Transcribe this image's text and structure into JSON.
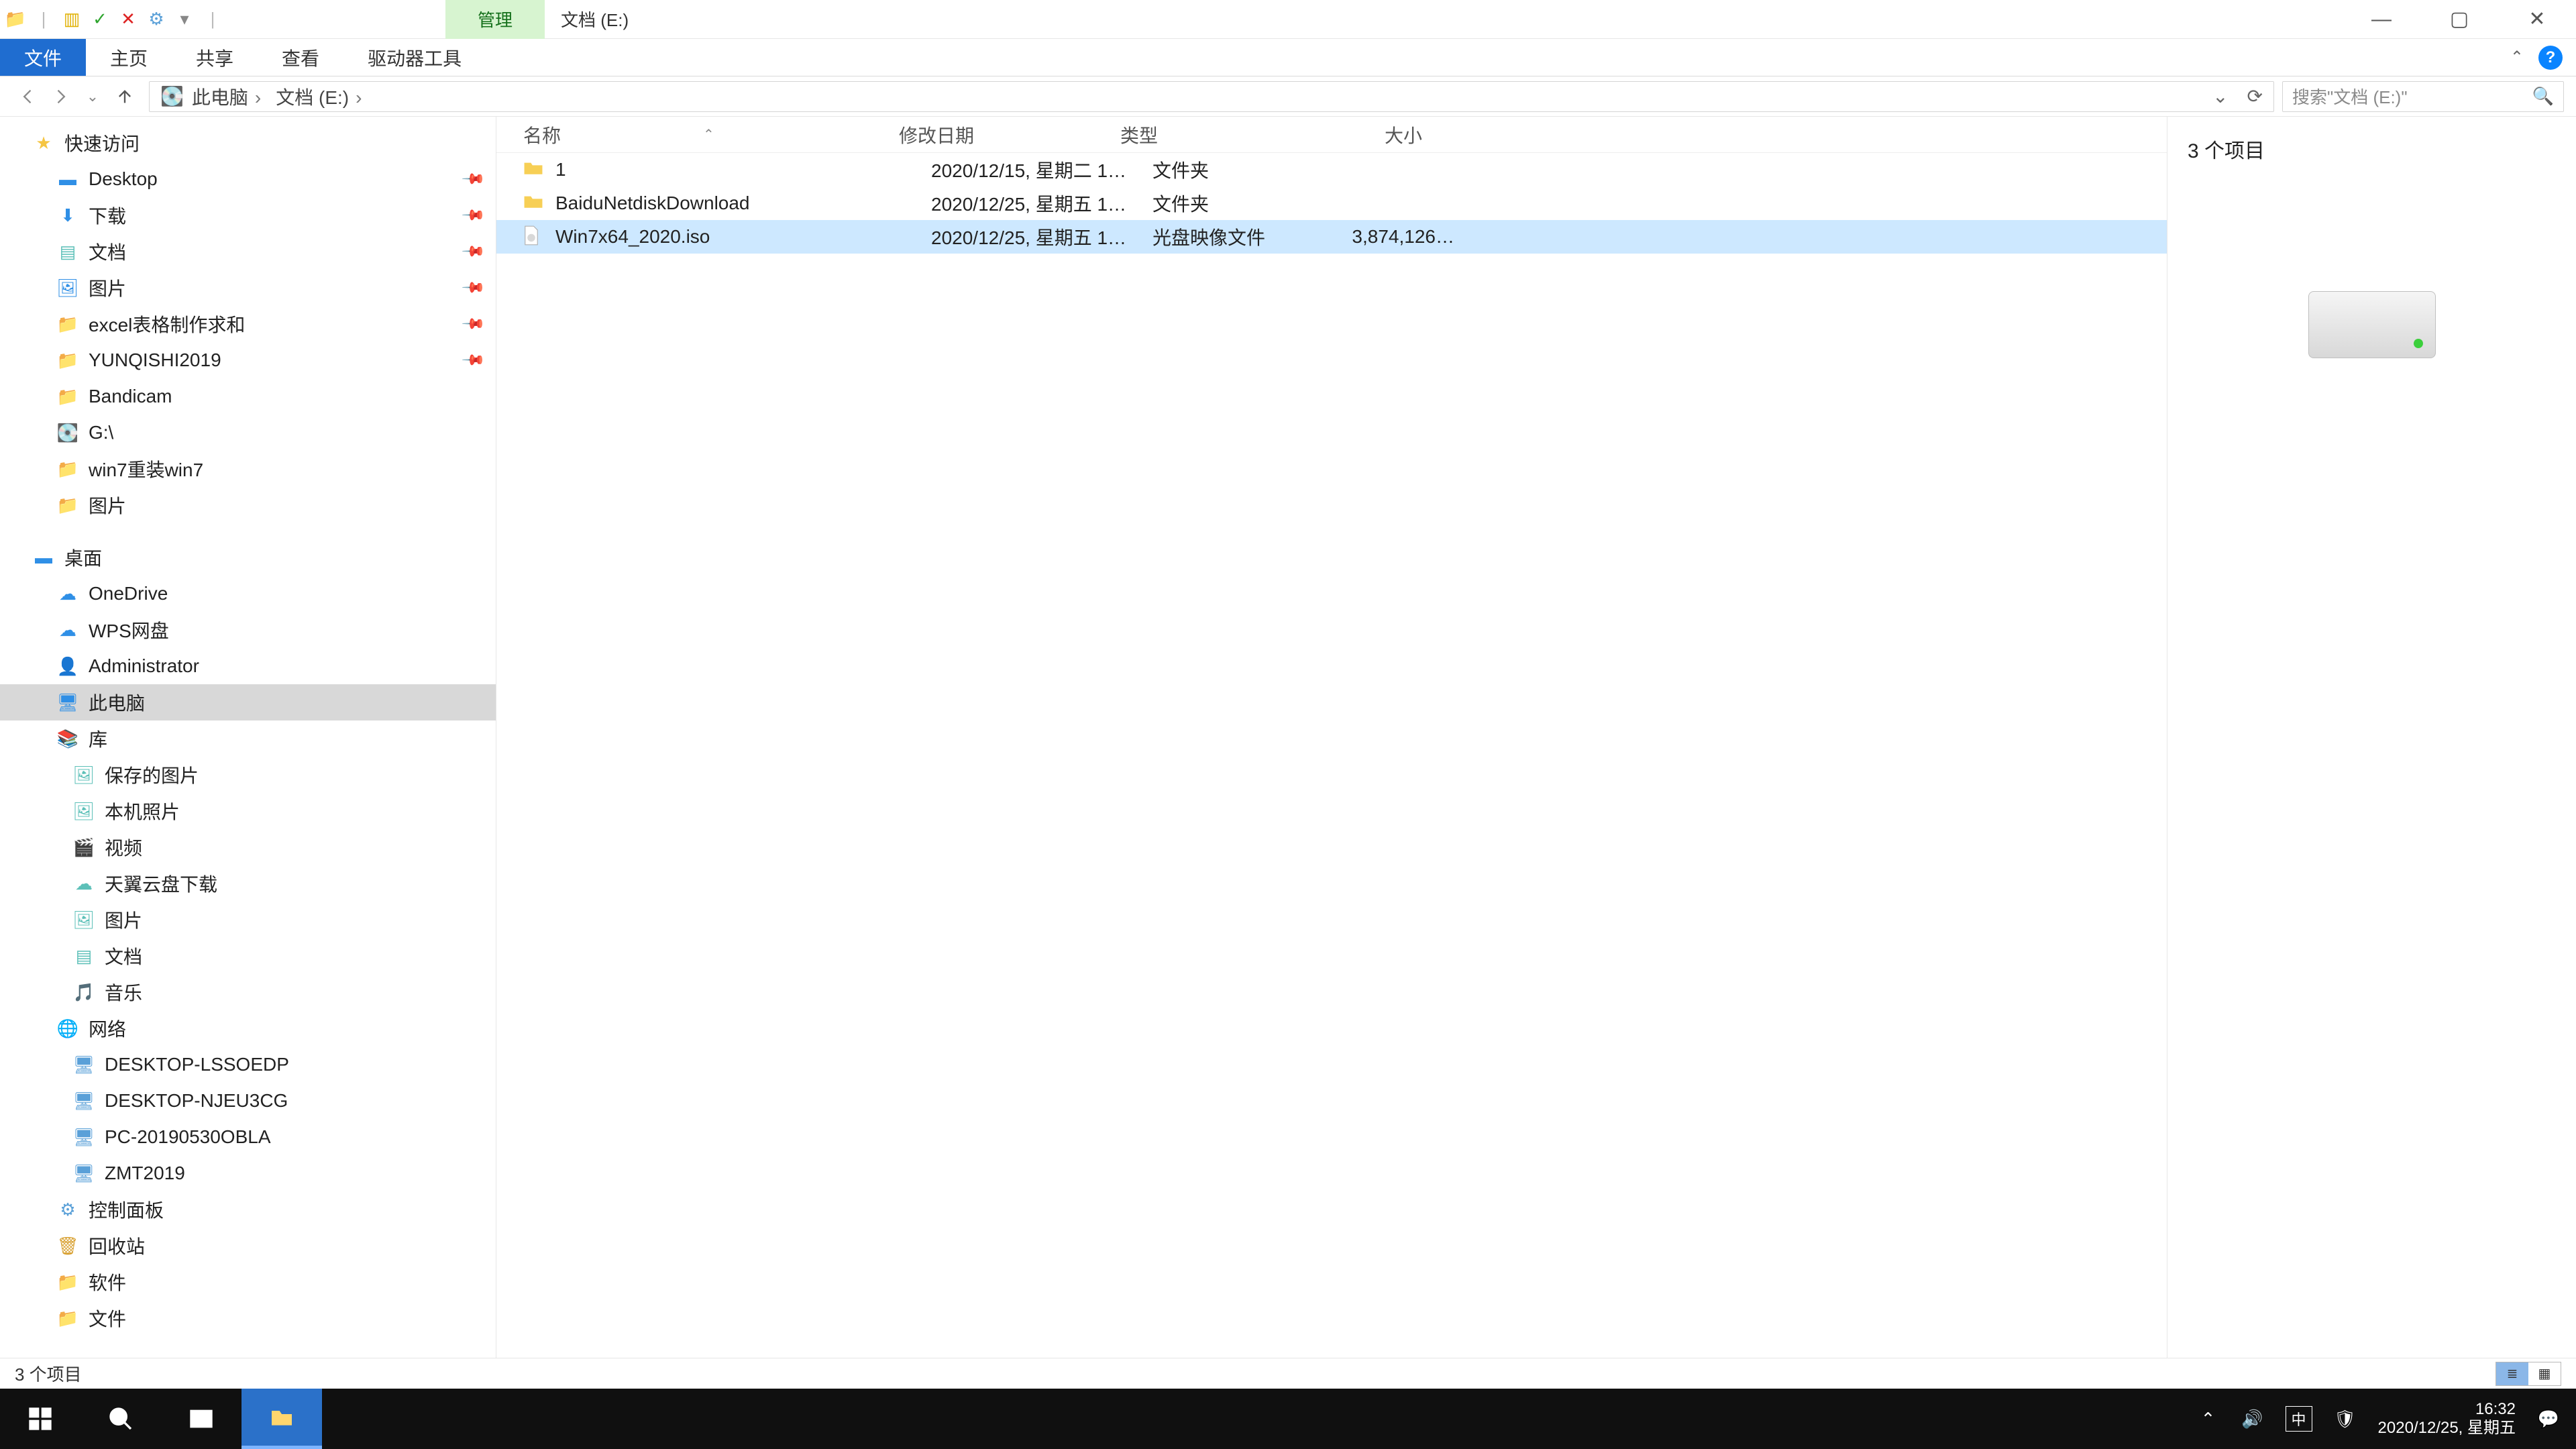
{
  "title": {
    "context_tab": "管理",
    "location_tab": "文档 (E:)"
  },
  "ribbon": {
    "file": "文件",
    "home": "主页",
    "share": "共享",
    "view": "查看",
    "drive": "驱动器工具"
  },
  "breadcrumb": {
    "root": "此电脑",
    "leaf": "文档 (E:)"
  },
  "search": {
    "placeholder": "搜索\"文档 (E:)\""
  },
  "columns": {
    "name": "名称",
    "date": "修改日期",
    "type": "类型",
    "size": "大小"
  },
  "rows": [
    {
      "icon": "folder",
      "name": "1",
      "date": "2020/12/15, 星期二 1…",
      "type": "文件夹",
      "size": ""
    },
    {
      "icon": "folder",
      "name": "BaiduNetdiskDownload",
      "date": "2020/12/25, 星期五 1…",
      "type": "文件夹",
      "size": ""
    },
    {
      "icon": "iso",
      "name": "Win7x64_2020.iso",
      "date": "2020/12/25, 星期五 1…",
      "type": "光盘映像文件",
      "size": "3,874,126…",
      "selected": true
    }
  ],
  "nav": {
    "quick": {
      "label": "快速访问"
    },
    "desktop": {
      "label": "Desktop"
    },
    "downloads": {
      "label": "下载"
    },
    "docs": {
      "label": "文档"
    },
    "pics": {
      "label": "图片"
    },
    "excel": {
      "label": "excel表格制作求和"
    },
    "yunqishi": {
      "label": "YUNQISHI2019"
    },
    "bandicam": {
      "label": "Bandicam"
    },
    "gdrive": {
      "label": "G:\\"
    },
    "win7re": {
      "label": "win7重装win7"
    },
    "pics2": {
      "label": "图片"
    },
    "zhuomian": {
      "label": "桌面"
    },
    "onedrive": {
      "label": "OneDrive"
    },
    "wps": {
      "label": "WPS网盘"
    },
    "admin": {
      "label": "Administrator"
    },
    "thispc": {
      "label": "此电脑"
    },
    "library": {
      "label": "库"
    },
    "savedpic": {
      "label": "保存的图片"
    },
    "localpic": {
      "label": "本机照片"
    },
    "video": {
      "label": "视频"
    },
    "tycloud": {
      "label": "天翼云盘下载"
    },
    "pics3": {
      "label": "图片"
    },
    "docs2": {
      "label": "文档"
    },
    "music": {
      "label": "音乐"
    },
    "network": {
      "label": "网络"
    },
    "pc1": {
      "label": "DESKTOP-LSSOEDP"
    },
    "pc2": {
      "label": "DESKTOP-NJEU3CG"
    },
    "pc3": {
      "label": "PC-20190530OBLA"
    },
    "pc4": {
      "label": "ZMT2019"
    },
    "cpanel": {
      "label": "控制面板"
    },
    "recycle": {
      "label": "回收站"
    },
    "soft": {
      "label": "软件"
    },
    "docs3": {
      "label": "文件"
    }
  },
  "preview": {
    "count_label": "3 个项目"
  },
  "status": {
    "items": "3 个项目"
  },
  "tray": {
    "ime": "中",
    "time": "16:32",
    "date": "2020/12/25, 星期五"
  }
}
